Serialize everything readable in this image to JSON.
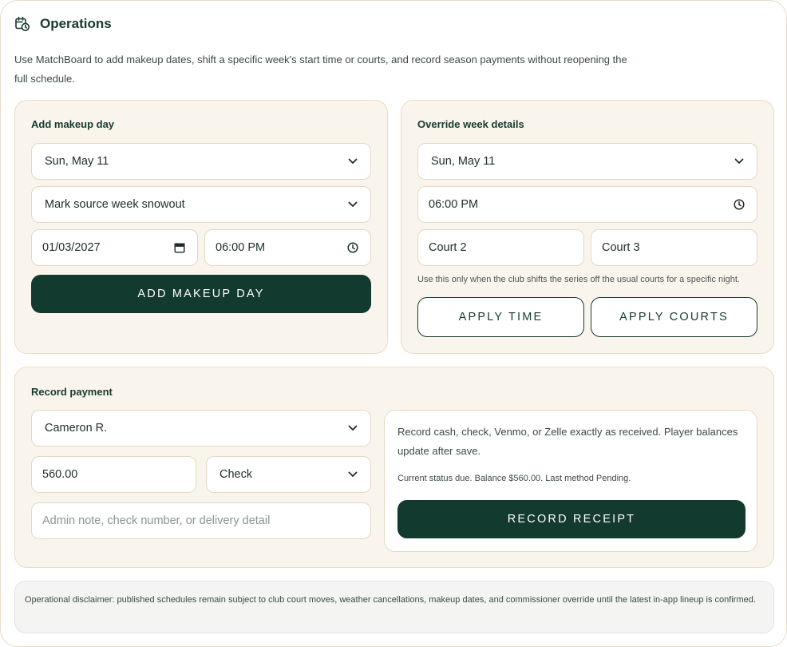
{
  "header": {
    "icon": "calendar-clock-icon",
    "title": "Operations",
    "intro": "Use MatchBoard to add makeup dates, shift a specific week's start time or courts, and record season payments without reopening the full schedule."
  },
  "makeup": {
    "title": "Add makeup day",
    "week_select": "Sun, May 11",
    "action_select": "Mark source week snowout",
    "date_value": "01/03/2027",
    "time_value": "06:00 PM",
    "button": "ADD MAKEUP DAY"
  },
  "override": {
    "title": "Override week details",
    "week_select": "Sun, May 11",
    "time_value": "06:00 PM",
    "court_a": "Court 2",
    "court_b": "Court 3",
    "hint": "Use this only when the club shifts the series off the usual courts for a specific night.",
    "apply_time": "APPLY TIME",
    "apply_courts": "APPLY COURTS"
  },
  "payment": {
    "title": "Record payment",
    "player_select": "Cameron R.",
    "amount": "560.00",
    "method_select": "Check",
    "note_placeholder": "Admin note, check number, or delivery detail",
    "info": "Record cash, check, Venmo, or Zelle exactly as received. Player balances update after save.",
    "status": "Current status due. Balance $560.00. Last method Pending.",
    "button": "RECORD RECEIPT"
  },
  "disclaimer": "Operational disclaimer: published schedules remain subject to club court moves, weather cancellations, makeup dates, and commissioner override until the latest in-app lineup is confirmed.",
  "colors": {
    "accent": "#133a2e",
    "card_bg": "#faf5ec",
    "card_border": "#e8dcc6"
  }
}
